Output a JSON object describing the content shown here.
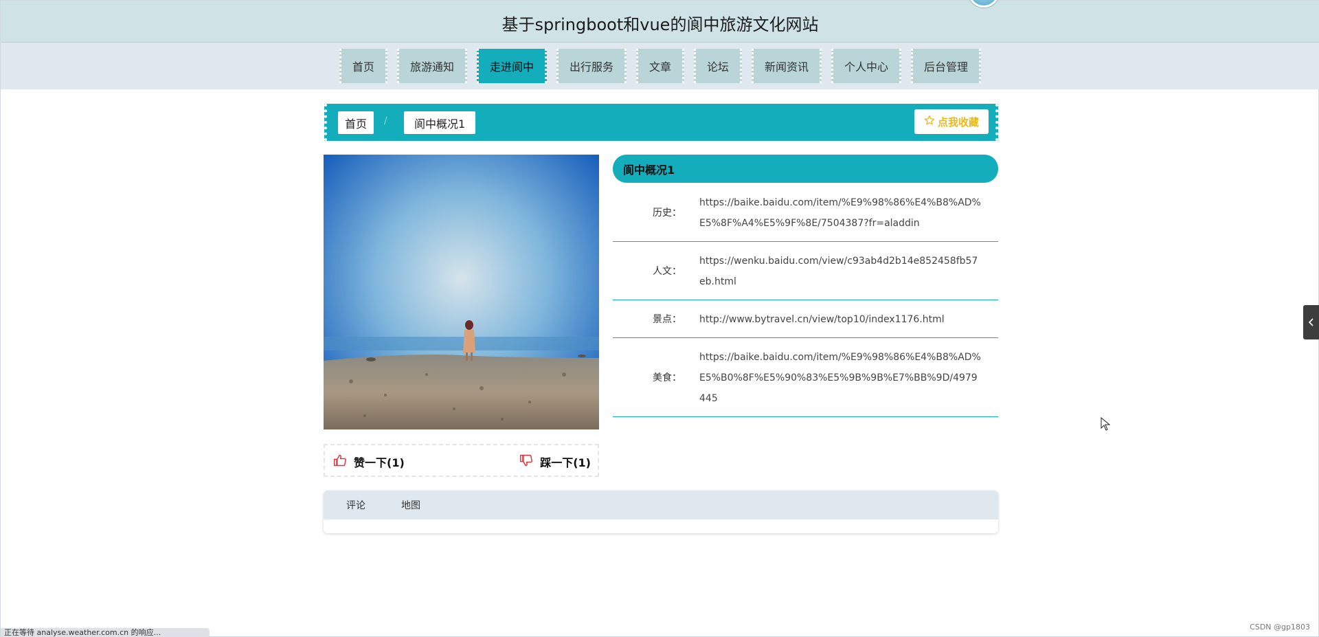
{
  "header": {
    "title": "基于springboot和vue的阆中旅游文化网站"
  },
  "nav": {
    "items": [
      {
        "label": "首页",
        "active": false
      },
      {
        "label": "旅游通知",
        "active": false
      },
      {
        "label": "走进阆中",
        "active": true
      },
      {
        "label": "出行服务",
        "active": false
      },
      {
        "label": "文章",
        "active": false
      },
      {
        "label": "论坛",
        "active": false
      },
      {
        "label": "新闻资讯",
        "active": false
      },
      {
        "label": "个人中心",
        "active": false
      },
      {
        "label": "后台管理",
        "active": false
      }
    ]
  },
  "breadcrumb": {
    "home": "首页",
    "separator": "/",
    "current": "阆中概况1"
  },
  "favorite": {
    "label": "点我收藏",
    "icon": "star-outline-icon",
    "color": "#e8b91a"
  },
  "detail": {
    "title": "阆中概况1",
    "rows": [
      {
        "label": "历史：",
        "value": "https://baike.baidu.com/item/%E9%98%86%E4%B8%AD%E5%8F%A4%E5%9F%8E/7504387?fr=aladdin"
      },
      {
        "label": "人文：",
        "value": "https://wenku.baidu.com/view/c93ab4d2b14e852458fb57eb.html"
      },
      {
        "label": "景点：",
        "value": "http://www.bytravel.cn/view/top10/index1176.html"
      },
      {
        "label": "美食：",
        "value": "https://baike.baidu.com/item/%E9%98%86%E4%B8%AD%E5%B0%8F%E5%90%83%E5%9B%9B%E7%BB%9D/4979445"
      }
    ]
  },
  "votes": {
    "up_label": "赞一下(1)",
    "down_label": "踩一下(1)",
    "icon_color": "#d9363e"
  },
  "tabs": [
    {
      "label": "评论"
    },
    {
      "label": "地图"
    }
  ],
  "status_bar": {
    "text": "正在等待 analyse.weather.com.cn 的响应..."
  },
  "watermark": {
    "text": "CSDN @gp1803"
  },
  "theme": {
    "primary": "#13adbb",
    "header_bg": "#cfe3e7",
    "nav_bg": "#dfe8ef",
    "nav_item_bg": "#b9d5d8"
  }
}
